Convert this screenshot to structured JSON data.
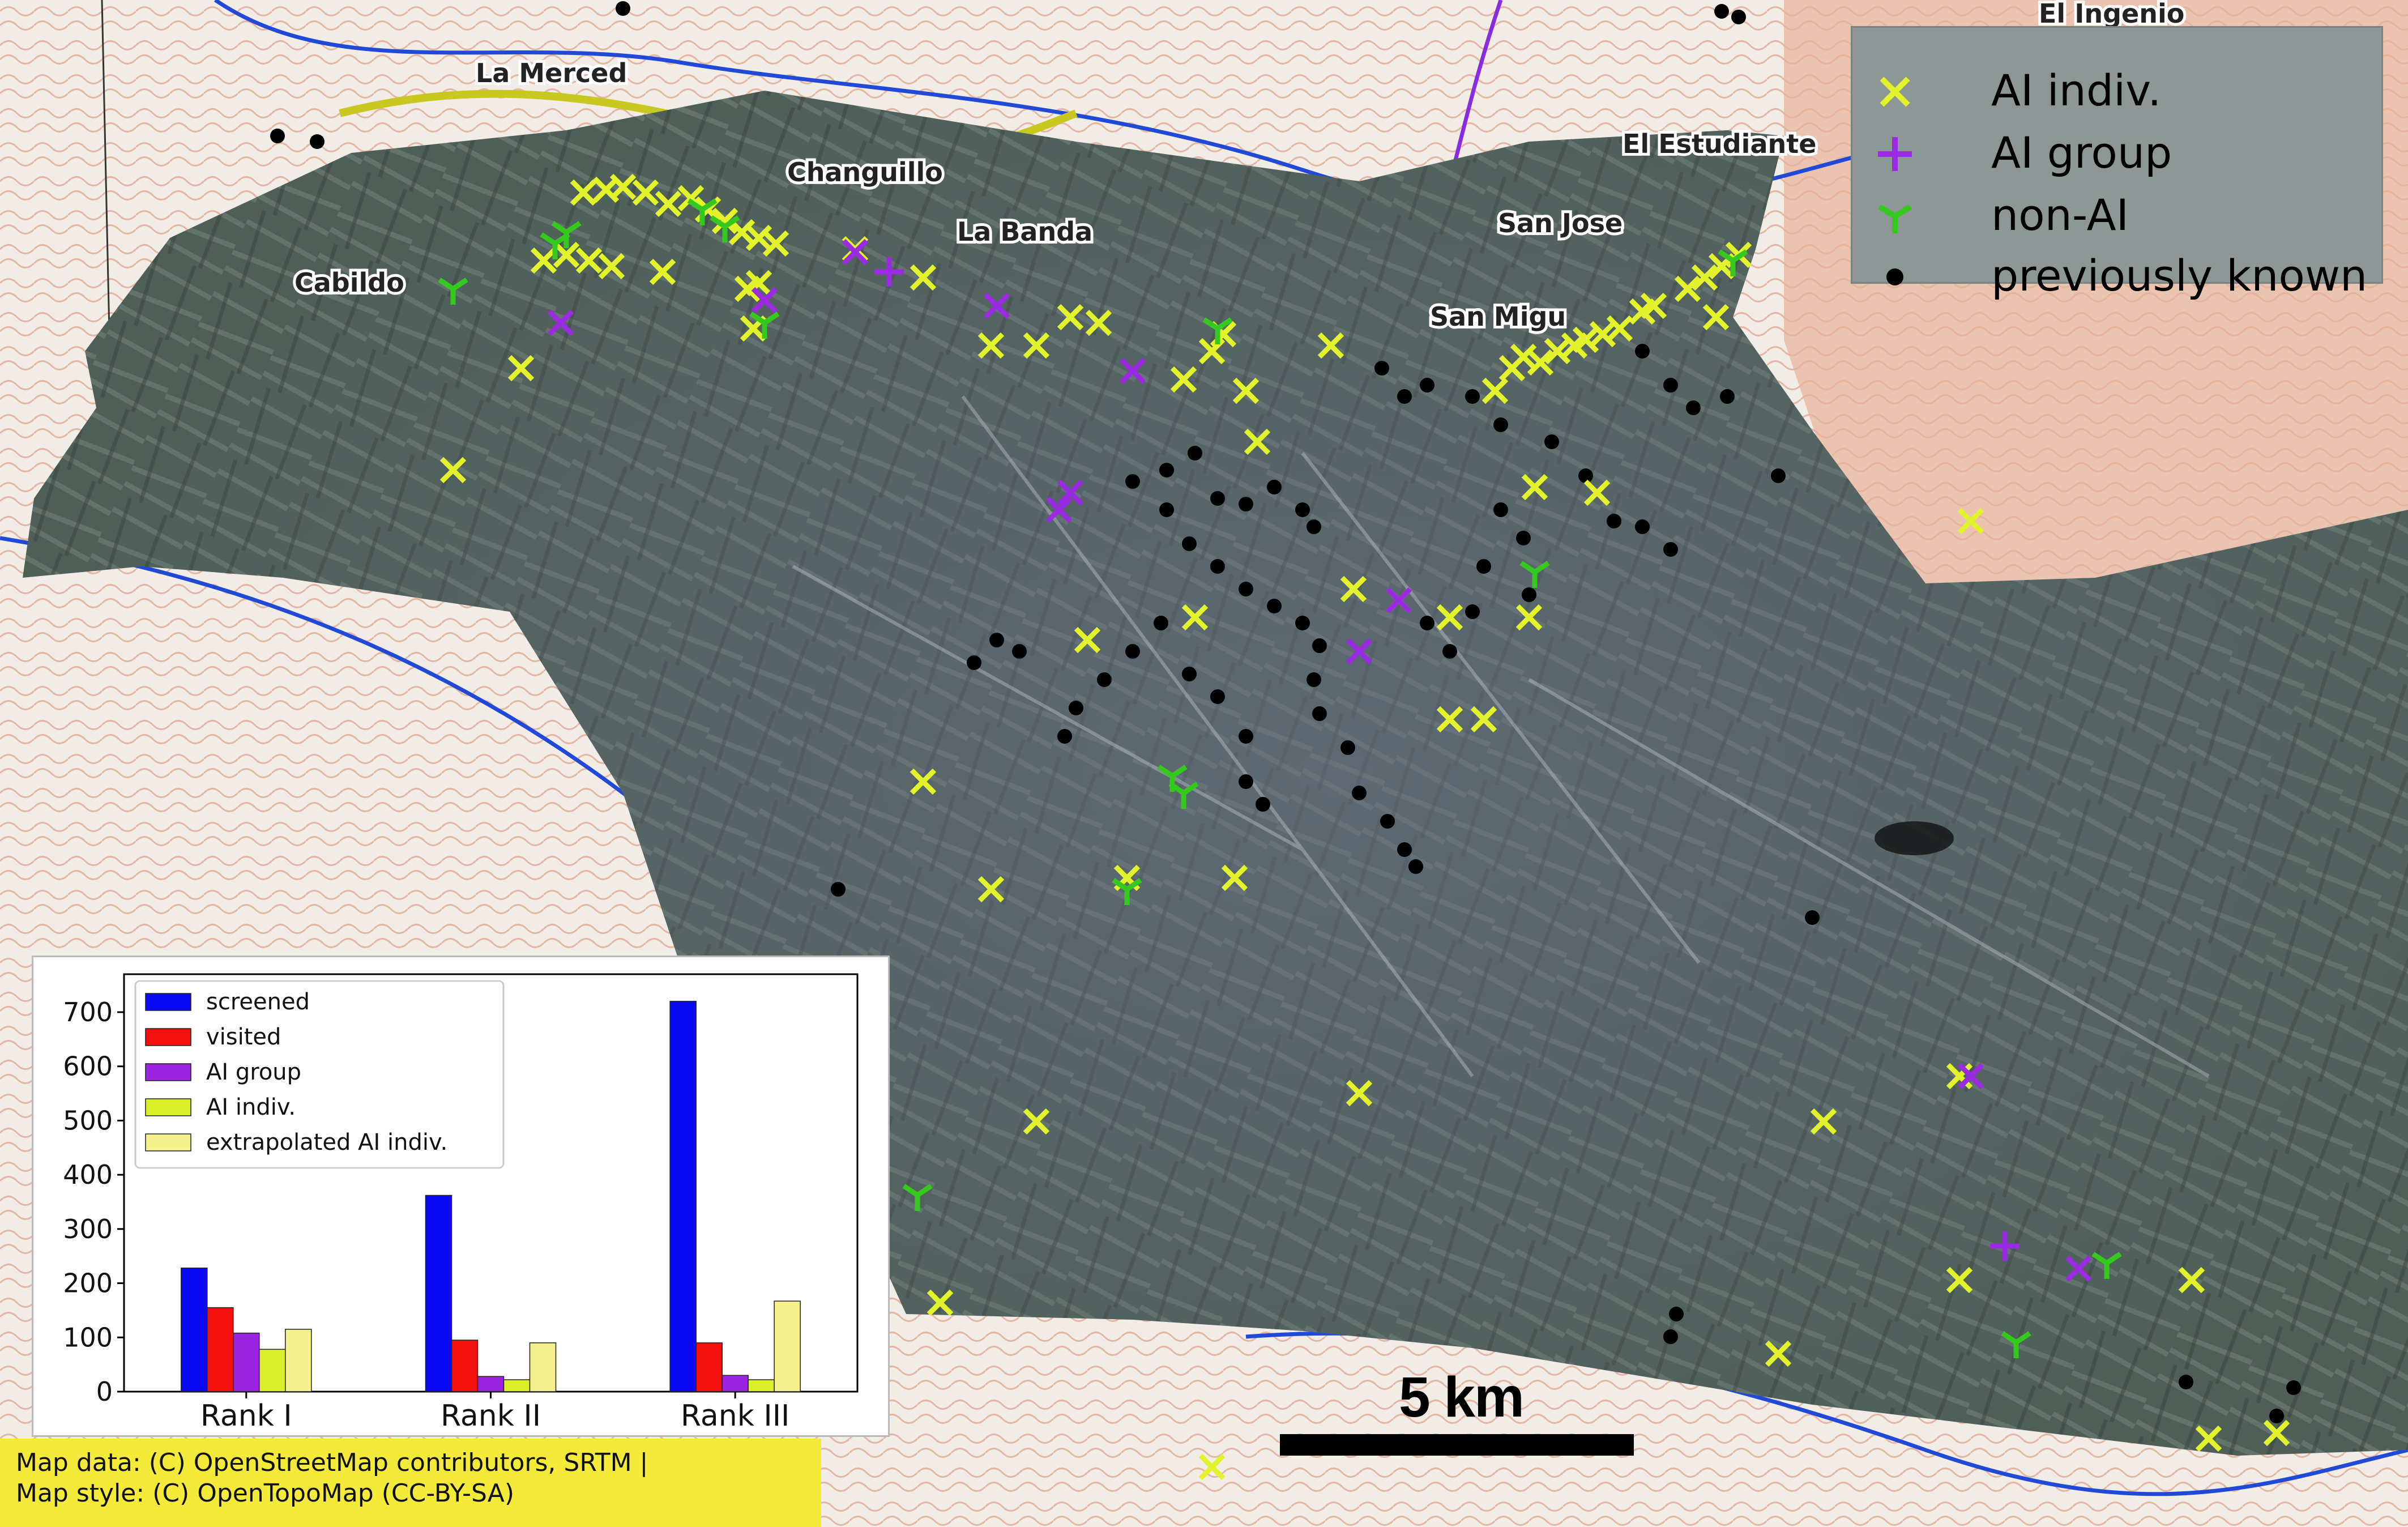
{
  "map": {
    "place_labels": [
      "La Merced",
      "Changuillo",
      "La Banda",
      "Cabildo",
      "El Estudiante",
      "San Jose",
      "San Migu",
      "El Ingenio"
    ],
    "attribution": [
      "Map data: (C) OpenStreetMap contributors, SRTM |",
      "Map style: (C) OpenTopoMap (CC-BY-SA)"
    ],
    "scale_label": "5 km"
  },
  "legend": {
    "items": [
      {
        "label": "AI indiv.",
        "marker": "x-icon",
        "color": "#e2f22b"
      },
      {
        "label": "AI group",
        "marker": "plus-icon",
        "color": "#9a2be2"
      },
      {
        "label": "non-AI",
        "marker": "tri-down-icon",
        "color": "#35c91f"
      },
      {
        "label": "previously known",
        "marker": "dot-icon",
        "color": "#000000"
      }
    ]
  },
  "chart_data": {
    "type": "bar",
    "categories": [
      "Rank I",
      "Rank II",
      "Rank III"
    ],
    "ylim": [
      0,
      770
    ],
    "yticks": [
      0,
      100,
      200,
      300,
      400,
      500,
      600,
      700
    ],
    "legend_position": "top-left",
    "series": [
      {
        "name": "screened",
        "color": "#0a0af5",
        "values": [
          228,
          362,
          720
        ]
      },
      {
        "name": "visited",
        "color": "#f51010",
        "values": [
          155,
          95,
          90
        ]
      },
      {
        "name": "AI group",
        "color": "#9a24e0",
        "values": [
          108,
          28,
          30
        ]
      },
      {
        "name": "AI indiv.",
        "color": "#d9f02a",
        "values": [
          78,
          22,
          22
        ]
      },
      {
        "name": "extrapolated AI indiv.",
        "color": "#f5f08e",
        "values": [
          115,
          90,
          167
        ]
      }
    ]
  }
}
